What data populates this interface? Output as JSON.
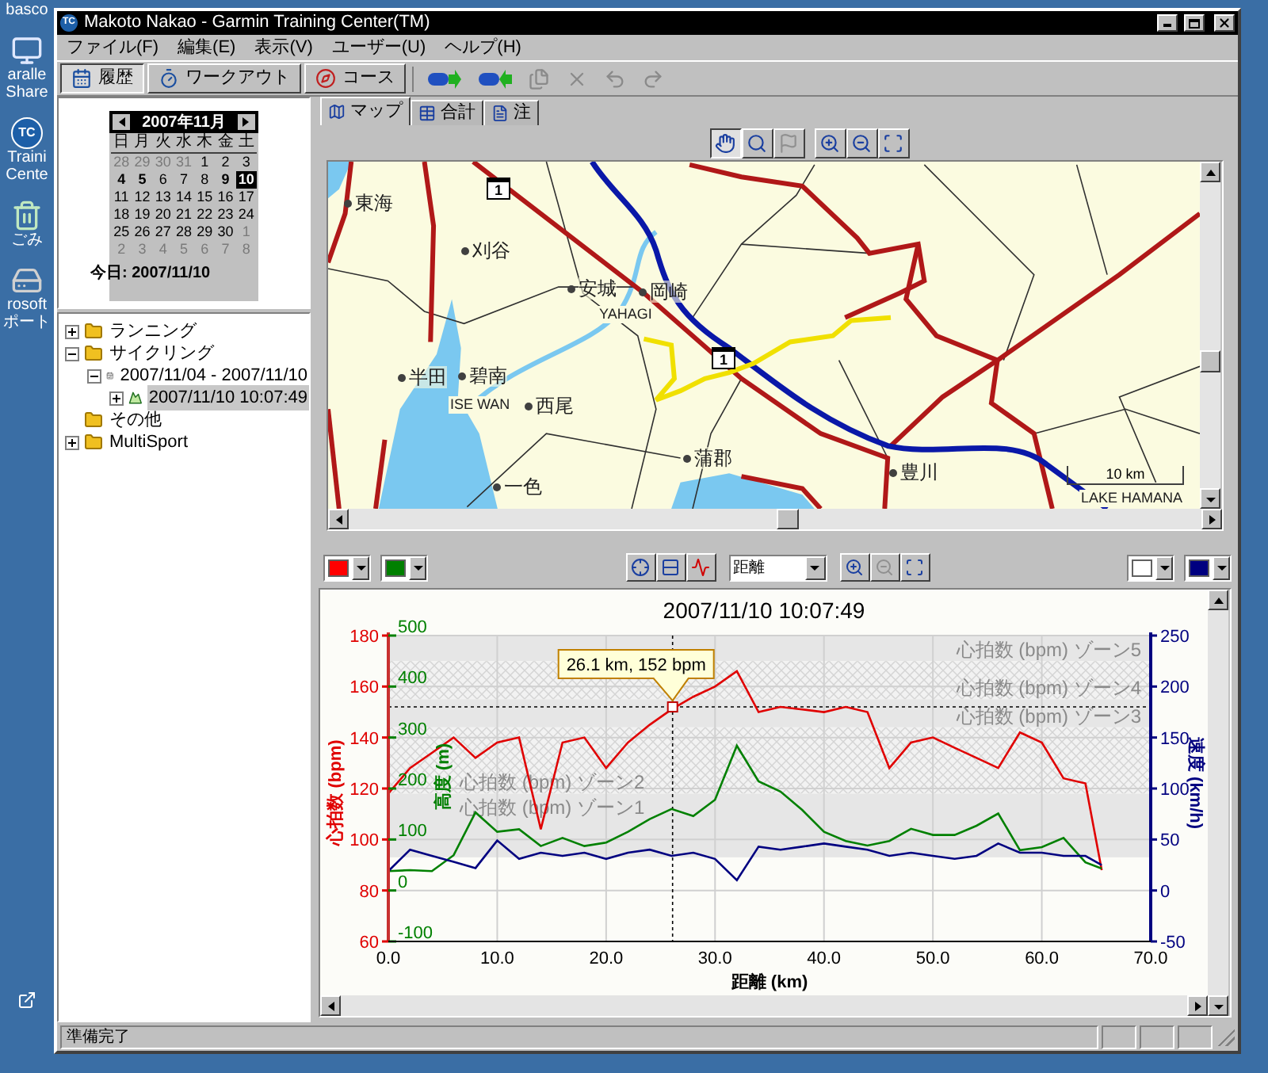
{
  "desktop": {
    "icons": [
      {
        "kind": "label-only",
        "label_lines": [
          "basco"
        ]
      },
      {
        "kind": "computer",
        "label_lines": [
          "aralle",
          "Share"
        ]
      },
      {
        "kind": "app",
        "badge": "TC",
        "label_lines": [
          "Traini",
          "Cente"
        ]
      },
      {
        "kind": "trash",
        "label_lines": [
          "ごみ"
        ]
      },
      {
        "kind": "drive",
        "label_lines": [
          "rosoft",
          "ポート"
        ]
      },
      {
        "kind": "shortcut"
      }
    ]
  },
  "window": {
    "icon_text": "TC",
    "title": "Makoto Nakao - Garmin Training Center(TM)"
  },
  "menu": [
    "ファイル(F)",
    "編集(E)",
    "表示(V)",
    "ユーザー(U)",
    "ヘルプ(H)"
  ],
  "toolbar": {
    "views": [
      {
        "kind": "history",
        "label": "履歴",
        "selected": true
      },
      {
        "kind": "workout",
        "label": "ワークアウト",
        "selected": false
      },
      {
        "kind": "course",
        "label": "コース",
        "selected": false
      }
    ],
    "actions": [
      {
        "kind": "send",
        "disabled": false
      },
      {
        "kind": "receive",
        "disabled": false
      },
      {
        "kind": "import",
        "disabled": true
      },
      {
        "kind": "delete",
        "disabled": true
      },
      {
        "kind": "undo",
        "disabled": true
      },
      {
        "kind": "redo",
        "disabled": true
      }
    ]
  },
  "calendar": {
    "month": "2007年11月",
    "weekdays": [
      "日",
      "月",
      "火",
      "水",
      "木",
      "金",
      "土"
    ],
    "days": [
      {
        "day": "28",
        "other_month": true,
        "has_workout": false,
        "selected": false
      },
      {
        "day": "29",
        "other_month": true,
        "has_workout": false,
        "selected": false
      },
      {
        "day": "30",
        "other_month": true,
        "has_workout": false,
        "selected": false
      },
      {
        "day": "31",
        "other_month": true,
        "has_workout": false,
        "selected": false
      },
      {
        "day": "1",
        "other_month": false,
        "has_workout": false,
        "selected": false
      },
      {
        "day": "2",
        "other_month": false,
        "has_workout": false,
        "selected": false
      },
      {
        "day": "3",
        "other_month": false,
        "has_workout": false,
        "selected": false
      },
      {
        "day": "4",
        "other_month": false,
        "has_workout": true,
        "selected": false
      },
      {
        "day": "5",
        "other_month": false,
        "has_workout": true,
        "selected": false
      },
      {
        "day": "6",
        "other_month": false,
        "has_workout": false,
        "selected": false
      },
      {
        "day": "7",
        "other_month": false,
        "has_workout": false,
        "selected": false
      },
      {
        "day": "8",
        "other_month": false,
        "has_workout": false,
        "selected": false
      },
      {
        "day": "9",
        "other_month": false,
        "has_workout": true,
        "selected": false
      },
      {
        "day": "10",
        "other_month": false,
        "has_workout": true,
        "selected": true
      },
      {
        "day": "11",
        "other_month": false,
        "has_workout": false,
        "selected": false
      },
      {
        "day": "12",
        "other_month": false,
        "has_workout": false,
        "selected": false
      },
      {
        "day": "13",
        "other_month": false,
        "has_workout": false,
        "selected": false
      },
      {
        "day": "14",
        "other_month": false,
        "has_workout": false,
        "selected": false
      },
      {
        "day": "15",
        "other_month": false,
        "has_workout": false,
        "selected": false
      },
      {
        "day": "16",
        "other_month": false,
        "has_workout": false,
        "selected": false
      },
      {
        "day": "17",
        "other_month": false,
        "has_workout": false,
        "selected": false
      },
      {
        "day": "18",
        "other_month": false,
        "has_workout": false,
        "selected": false
      },
      {
        "day": "19",
        "other_month": false,
        "has_workout": false,
        "selected": false
      },
      {
        "day": "20",
        "other_month": false,
        "has_workout": false,
        "selected": false
      },
      {
        "day": "21",
        "other_month": false,
        "has_workout": false,
        "selected": false
      },
      {
        "day": "22",
        "other_month": false,
        "has_workout": false,
        "selected": false
      },
      {
        "day": "23",
        "other_month": false,
        "has_workout": false,
        "selected": false
      },
      {
        "day": "24",
        "other_month": false,
        "has_workout": false,
        "selected": false
      },
      {
        "day": "25",
        "other_month": false,
        "has_workout": false,
        "selected": false
      },
      {
        "day": "26",
        "other_month": false,
        "has_workout": false,
        "selected": false
      },
      {
        "day": "27",
        "other_month": false,
        "has_workout": false,
        "selected": false
      },
      {
        "day": "28",
        "other_month": false,
        "has_workout": false,
        "selected": false
      },
      {
        "day": "29",
        "other_month": false,
        "has_workout": false,
        "selected": false
      },
      {
        "day": "30",
        "other_month": false,
        "has_workout": false,
        "selected": false
      },
      {
        "day": "1",
        "other_month": true,
        "has_workout": false,
        "selected": false
      },
      {
        "day": "2",
        "other_month": true,
        "has_workout": false,
        "selected": false
      },
      {
        "day": "3",
        "other_month": true,
        "has_workout": false,
        "selected": false
      },
      {
        "day": "4",
        "other_month": true,
        "has_workout": false,
        "selected": false
      },
      {
        "day": "5",
        "other_month": true,
        "has_workout": false,
        "selected": false
      },
      {
        "day": "6",
        "other_month": true,
        "has_workout": false,
        "selected": false
      },
      {
        "day": "7",
        "other_month": true,
        "has_workout": false,
        "selected": false
      },
      {
        "day": "8",
        "other_month": true,
        "has_workout": false,
        "selected": false
      }
    ],
    "today": "今日: 2007/11/10"
  },
  "tree": [
    {
      "kind": "folder",
      "label": "ランニング",
      "has_children": true,
      "expanded": false,
      "selected": false
    },
    {
      "kind": "folder",
      "label": "サイクリング",
      "has_children": true,
      "expanded": true,
      "selected": false,
      "children": [
        {
          "kind": "week",
          "label": "2007/11/04 - 2007/11/10",
          "has_children": true,
          "expanded": true,
          "selected": false,
          "children": [
            {
              "kind": "activity",
              "label": "2007/11/10 10:07:49",
              "has_children": true,
              "expanded": false,
              "selected": true
            }
          ]
        }
      ]
    },
    {
      "kind": "folder",
      "label": "その他",
      "selected": false
    },
    {
      "kind": "folder",
      "label": "MultiSport",
      "has_children": true,
      "expanded": false,
      "selected": false
    }
  ],
  "map_tabs": [
    {
      "kind": "map",
      "label": "マップ",
      "selected": true
    },
    {
      "kind": "totals",
      "label": "合計",
      "selected": false
    },
    {
      "kind": "notes",
      "label": "注",
      "selected": false
    }
  ],
  "map_tools": [
    {
      "kind": "pan",
      "selected": true,
      "disabled": false
    },
    {
      "kind": "zoom",
      "selected": false,
      "disabled": false
    },
    {
      "kind": "flag",
      "selected": false,
      "disabled": true
    },
    {
      "kind": "zoom-in",
      "selected": false,
      "disabled": false
    },
    {
      "kind": "zoom-out",
      "selected": false,
      "disabled": false
    },
    {
      "kind": "fit",
      "selected": false,
      "disabled": false
    }
  ],
  "map": {
    "places": [
      {
        "kind": "town",
        "name": "東海"
      },
      {
        "kind": "town",
        "name": "刈谷"
      },
      {
        "kind": "town",
        "name": "安城"
      },
      {
        "kind": "town",
        "name": "岡崎"
      },
      {
        "kind": "label",
        "name": "YAHAGI"
      },
      {
        "kind": "town",
        "name": "半田"
      },
      {
        "kind": "town",
        "name": "碧南"
      },
      {
        "kind": "label",
        "name": "ISE WAN"
      },
      {
        "kind": "town",
        "name": "西尾"
      },
      {
        "kind": "town",
        "name": "蒲郡"
      },
      {
        "kind": "town",
        "name": "一色"
      },
      {
        "kind": "town",
        "name": "豊川"
      },
      {
        "kind": "shield",
        "name": "1"
      },
      {
        "kind": "shield",
        "name": "1"
      },
      {
        "kind": "scale",
        "name": "10 km"
      },
      {
        "kind": "label",
        "name": "LAKE HAMANA"
      }
    ]
  },
  "chart_toolbar": {
    "left_color_pickers": [
      {
        "color": "#ff0000"
      },
      {
        "color": "#008000"
      }
    ],
    "modes": [
      {
        "kind": "crosshair"
      },
      {
        "kind": "split"
      },
      {
        "kind": "curve"
      }
    ],
    "x_axis_select": {
      "value": "距離"
    },
    "zoom_tools": [
      {
        "kind": "zoom-in",
        "disabled": false
      },
      {
        "kind": "zoom-out",
        "disabled": true
      },
      {
        "kind": "fit",
        "disabled": false
      }
    ],
    "right_color_pickers": [
      {
        "color": "#ffffff"
      },
      {
        "color": "#000080"
      }
    ]
  },
  "chart": {
    "chart_data": {
      "type": "line",
      "title": "2007/11/10 10:07:49",
      "xlabel": "距離 (km)",
      "ylabel": "心拍数 (bpm)",
      "x": [
        0,
        2,
        4,
        6,
        8,
        10,
        12,
        14,
        16,
        18,
        20,
        22,
        24,
        26,
        28,
        30,
        32,
        34,
        36,
        38,
        40,
        42,
        44,
        46,
        48,
        50,
        52,
        54,
        56,
        58,
        60,
        62,
        64,
        65.5
      ],
      "series": [
        {
          "color": "#e00000",
          "values": [
            118,
            128,
            134,
            140,
            132,
            138,
            140,
            104,
            138,
            140,
            128,
            138,
            145,
            151,
            156,
            160,
            166,
            150,
            152,
            151,
            150,
            152,
            150,
            128,
            138,
            140,
            136,
            132,
            128,
            142,
            138,
            124,
            122,
            88
          ]
        },
        {
          "color": "#008000",
          "axis": "y2",
          "values": [
            38,
            40,
            38,
            69,
            153,
            115,
            120,
            87,
            103,
            87,
            94,
            115,
            140,
            160,
            146,
            178,
            284,
            214,
            194,
            158,
            115,
            97,
            88,
            97,
            121,
            109,
            109,
            127,
            151,
            79,
            85,
            103,
            55,
            43
          ]
        },
        {
          "color": "#000080",
          "axis": "y3",
          "values": [
            19,
            40,
            34,
            28,
            22,
            49,
            31,
            37,
            34,
            37,
            31,
            37,
            40,
            34,
            37,
            31,
            10,
            43,
            40,
            43,
            46,
            43,
            40,
            34,
            37,
            34,
            31,
            34,
            46,
            37,
            37,
            34,
            34,
            25
          ]
        }
      ],
      "xlim": [
        0,
        70
      ],
      "ylim": [
        60,
        180
      ],
      "xticks": [
        {
          "value": 0,
          "label": "0.0"
        },
        {
          "value": 10,
          "label": "10.0"
        },
        {
          "value": 20,
          "label": "20.0"
        },
        {
          "value": 30,
          "label": "30.0"
        },
        {
          "value": 40,
          "label": "40.0"
        },
        {
          "value": 50,
          "label": "50.0"
        },
        {
          "value": 60,
          "label": "60.0"
        },
        {
          "value": 70,
          "label": "70.0"
        }
      ],
      "yticks": [
        60,
        80,
        100,
        120,
        140,
        160,
        180
      ],
      "y2label": "高度 (m)",
      "y2lim": [
        -100,
        500
      ],
      "y2ticks": [
        -100,
        0,
        100,
        200,
        300,
        400,
        500
      ],
      "y3label": "速度 (km/h)",
      "y3lim": [
        -50,
        250
      ],
      "y3ticks": [
        -50,
        0,
        50,
        100,
        150,
        200,
        250
      ],
      "grid": true,
      "bands": [
        {
          "axis": "y",
          "label": "心拍数 (bpm) ゾーン5",
          "from": 170,
          "to": 180
        },
        {
          "axis": "y",
          "label": "心拍数 (bpm) ゾーン4",
          "from": 155,
          "to": 170
        },
        {
          "axis": "y",
          "label": "心拍数 (bpm) ゾーン3",
          "from": 144,
          "to": 155
        },
        {
          "axis": "y",
          "label": "心拍数 (bpm) ゾーン2",
          "from": 118,
          "to": 144
        },
        {
          "axis": "y",
          "label": "心拍数 (bpm) ゾーン1",
          "from": 93,
          "to": 118
        }
      ],
      "ref_lines": [
        {
          "axis": "x",
          "value": 26.1
        },
        {
          "axis": "y",
          "value": 152
        }
      ],
      "annotations": [
        {
          "x": 26.1,
          "y": 152,
          "text": "26.1 km, 152 bpm"
        }
      ]
    }
  },
  "status_bar": {
    "text": "準備完了"
  }
}
